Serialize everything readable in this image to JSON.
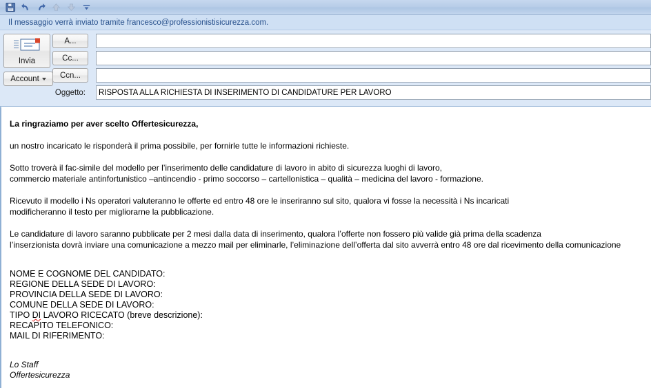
{
  "toolbar": {
    "buttons": [
      {
        "name": "save-icon",
        "label": "Salva",
        "enabled": true
      },
      {
        "name": "undo-icon",
        "label": "Annulla",
        "enabled": true
      },
      {
        "name": "redo-icon",
        "label": "Ripeti",
        "enabled": true
      },
      {
        "name": "previous-icon",
        "label": "Precedente",
        "enabled": false
      },
      {
        "name": "next-icon",
        "label": "Successivo",
        "enabled": false
      },
      {
        "name": "customize-toolbar-icon",
        "label": "Personalizza",
        "enabled": true
      }
    ]
  },
  "infobar": {
    "text": "Il messaggio verrà inviato tramite francesco@professionistisicurezza.com."
  },
  "compose": {
    "send_label": "Invia",
    "account_label": "Account",
    "to_label": "A...",
    "cc_label": "Cc...",
    "bcc_label": "Ccn...",
    "to_value": "",
    "cc_value": "",
    "bcc_value": "",
    "subject_label": "Oggetto:",
    "subject_value": "RISPOSTA ALLA RICHIESTA DI INSERIMENTO DI CANDIDATURE PER LAVORO"
  },
  "message": {
    "greeting": "La ringraziamo per aver scelto Offertesicurezza,",
    "para1": "un nostro incaricato le risponderà il prima possibile, per fornirle tutte le informazioni richieste.",
    "para2_line1": "Sotto troverà il fac-simile del modello per l’inserimento delle candidature di lavoro in abito di sicurezza luoghi di lavoro,",
    "para2_line2": "commercio materiale antinfortunistico –antincendio - primo soccorso – cartellonistica – qualità – medicina del lavoro - formazione.",
    "para3_line1": "Ricevuto il modello i Ns operatori valuteranno le offerte ed entro 48 ore le inseriranno sul sito, qualora vi fosse la necessità i Ns incaricati",
    "para3_line2": "modificheranno il testo per migliorarne la pubblicazione.",
    "para4_line1": "Le candidature di lavoro saranno pubblicate per 2 mesi dalla data di inserimento, qualora l’offerte non fossero più valide già prima della scadenza",
    "para4_line2": "l’inserzionista dovrà inviare una comunicazione a mezzo mail per eliminarle, l’eliminazione dell’offerta dal sito avverrà entro 48 ore dal ricevimento della comunicazione",
    "form_fields": [
      "NOME E COGNOME DEL CANDIDATO:",
      "REGIONE DELLA SEDE DI LAVORO:",
      "PROVINCIA DELLA SEDE DI LAVORO:",
      "COMUNE DELLA SEDE DI LAVORO:",
      "TIPO DI LAVORO RICECATO (breve descrizione):",
      "RECAPITO TELEFONICO:",
      "MAIL DI RIFERIMENTO:"
    ],
    "field_tipo_prefix": "TIPO ",
    "field_tipo_misspelled": "DI",
    "field_tipo_suffix": " LAVORO RICECATO (breve descrizione):",
    "signature_line1": "Lo Staff",
    "signature_line2": "Offertesicurezza"
  },
  "colors": {
    "toolbar_top": "#c6d8ef",
    "infobar_bg": "#cfe0f4",
    "infobar_text": "#27508c",
    "header_bg": "#dce8f7",
    "border_blue": "#8fb0d4",
    "spellcheck_red": "#e02020"
  }
}
